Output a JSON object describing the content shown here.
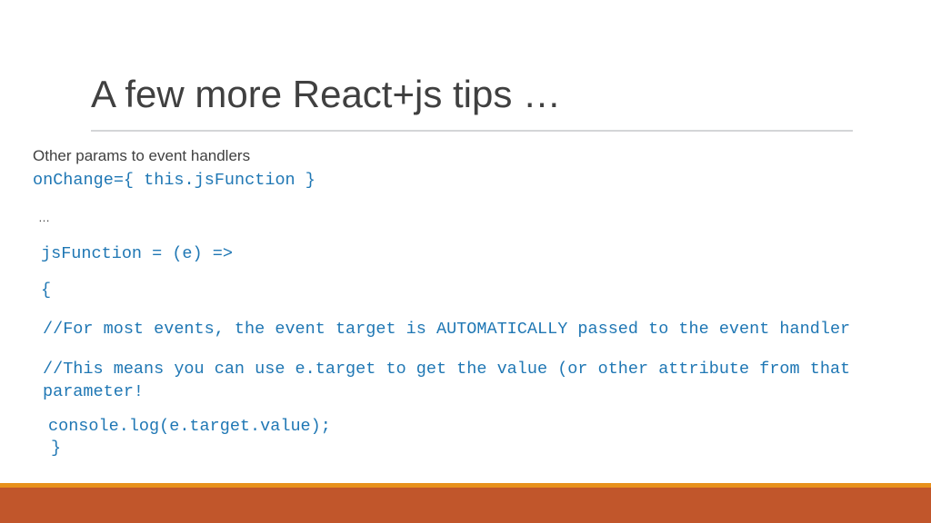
{
  "slide": {
    "title": "A few more React+js tips …",
    "background_color": "#ffffff",
    "title_color": "#404040",
    "rule_color": "#d4d5d7",
    "code_color": "#1f77b4",
    "body_color": "#404040",
    "footer_stripe_color": "#e8911c",
    "footer_band_color": "#c1562b"
  },
  "body": {
    "heading": "Other params to event handlers",
    "lines": [
      {
        "id": "l1",
        "kind": "code",
        "text": "onChange={ this.jsFunction }"
      },
      {
        "id": "l2",
        "kind": "ellipsis",
        "text": "…"
      },
      {
        "id": "l3",
        "kind": "code",
        "text": "jsFunction = (e) =>"
      },
      {
        "id": "l4",
        "kind": "code",
        "text": "{"
      },
      {
        "id": "l5",
        "kind": "code-wrap",
        "text": "//For most events, the event target is AUTOMATICALLY passed to the event handler"
      },
      {
        "id": "l6",
        "kind": "code-wrap",
        "text": "//This means you can use e.target to get the value (or other attribute from that parameter!"
      },
      {
        "id": "l7",
        "kind": "code",
        "text": "console.log(e.target.value);"
      },
      {
        "id": "l8",
        "kind": "code",
        "text": "}"
      }
    ]
  }
}
